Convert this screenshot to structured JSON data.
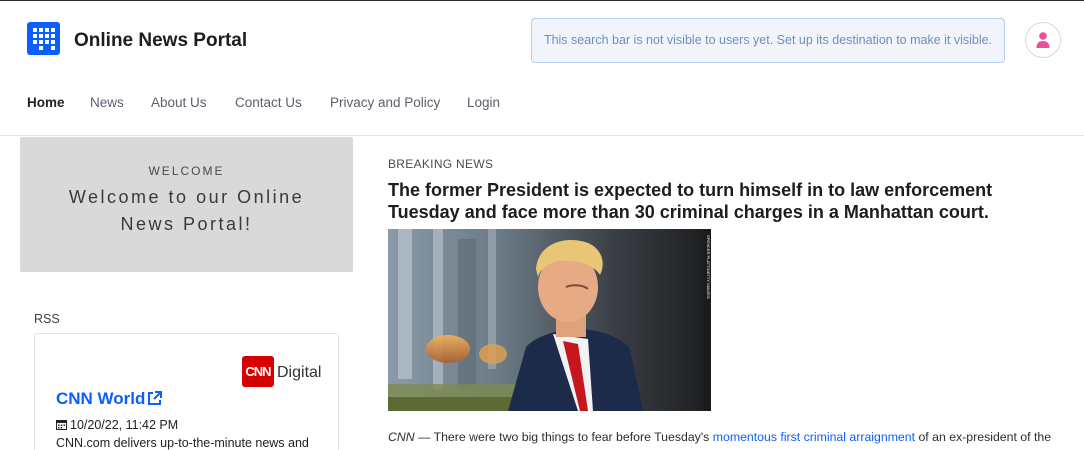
{
  "header": {
    "site_title": "Online News Portal",
    "search_placeholder": "This search bar is not visible to users yet. Set up its destination to make it visible.",
    "logo_icon": "grid-logo-icon",
    "avatar_icon": "user-icon",
    "brand_color": "#0b5fff"
  },
  "nav": {
    "items": [
      {
        "label": "Home",
        "active": true
      },
      {
        "label": "News",
        "active": false
      },
      {
        "label": "About Us",
        "active": false
      },
      {
        "label": "Contact Us",
        "active": false
      },
      {
        "label": "Privacy and Policy",
        "active": false
      },
      {
        "label": "Login",
        "active": false
      }
    ]
  },
  "welcome": {
    "label": "WELCOME",
    "text": "Welcome to our Online News Portal!"
  },
  "rss": {
    "label": "RSS",
    "feed": {
      "logo_text": "CNN",
      "logo_suffix": "Digital",
      "title": "CNN World",
      "date": "10/20/22, 11:42 PM",
      "description": "CNN.com delivers up-to-the-minute news and"
    }
  },
  "article": {
    "eyebrow": "BREAKING NEWS",
    "headline": "The former President is expected to turn himself in to law enforcement Tuesday and face more than 30 criminal charges in a Manhattan court.",
    "photo_credit": "SPENCER PLATT/GETTY IMAGES",
    "source": "CNN",
    "intro": " — There were two big things to fear before Tuesday's ",
    "link_text": "momentous first criminal arraignment",
    "outro": " of an ex-president of the United States"
  }
}
